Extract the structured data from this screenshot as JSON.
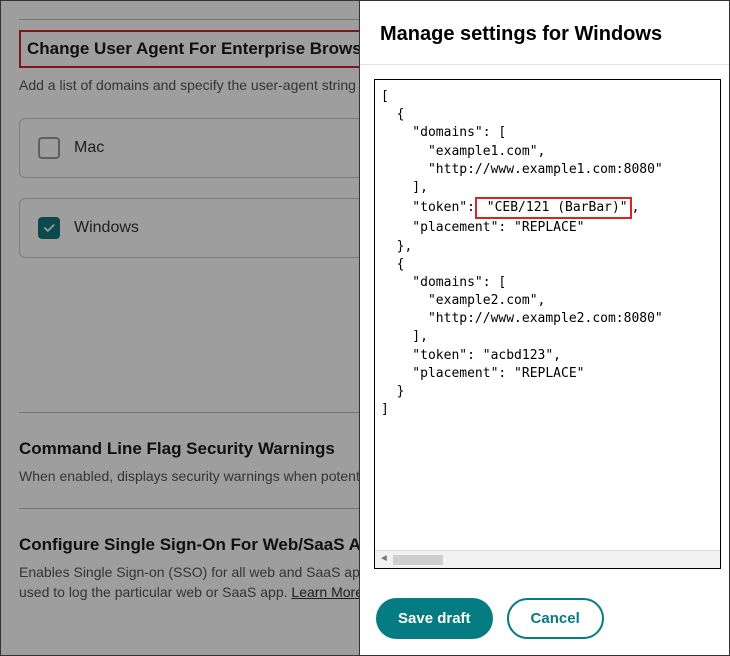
{
  "base": {
    "section1": {
      "title": "Change User Agent For Enterprise Browser",
      "desc": "Add a list of domains and specify the user-agent string mo domains."
    },
    "os": {
      "mac": {
        "label": "Mac",
        "checked": false
      },
      "windows": {
        "label": "Windows",
        "checked": true
      }
    },
    "section2": {
      "title": "Command Line Flag Security Warnings",
      "desc": "When enabled, displays security warnings when potentiall to launch the browser."
    },
    "section3": {
      "title": "Configure Single Sign-On For Web/SaaS Apps",
      "desc": "Enables Single Sign-on (SSO) for all web and SaaS apps f IdP domains added, as long as the same IdP is used to log the particular web or SaaS app. ",
      "link": "Learn More."
    }
  },
  "modal": {
    "title": "Manage settings for Windows",
    "code": {
      "pre1": "[\n  {\n    \"domains\": [\n      \"example1.com\",\n      \"http://www.example1.com:8080\"\n    ],\n    \"token\":",
      "highlight": " \"CEB/121 (BarBar)\"",
      "post1": ",\n    \"placement\": \"REPLACE\"\n  },\n  {\n    \"domains\": [\n      \"example2.com\",\n      \"http://www.example2.com:8080\"\n    ],\n    \"token\": \"acbd123\",\n    \"placement\": \"REPLACE\"\n  }\n]"
    },
    "save_label": "Save draft",
    "cancel_label": "Cancel"
  }
}
